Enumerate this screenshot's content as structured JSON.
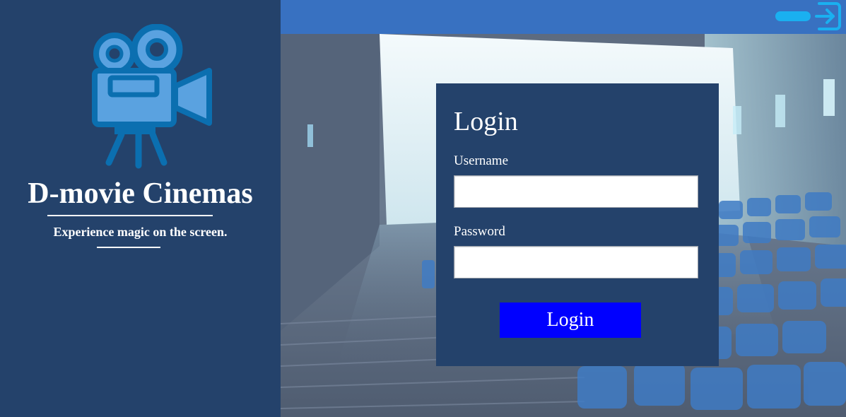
{
  "sidebar": {
    "logo_icon": "movie-camera-icon",
    "brand_name": "D-movie Cinemas",
    "tagline": "Experience magic on the screen."
  },
  "topbar": {
    "toggle_icon": "toggle-pill",
    "exit_icon": "sign-in-icon"
  },
  "login": {
    "title": "Login",
    "username_label": "Username",
    "username_value": "",
    "username_placeholder": "",
    "password_label": "Password",
    "password_value": "",
    "password_placeholder": "",
    "submit_label": "Login"
  },
  "colors": {
    "sidebar_bg": "#24426b",
    "topbar_bg": "#3871c1",
    "button_bg": "#0000ff",
    "accent_cyan": "#1ab0f0"
  }
}
